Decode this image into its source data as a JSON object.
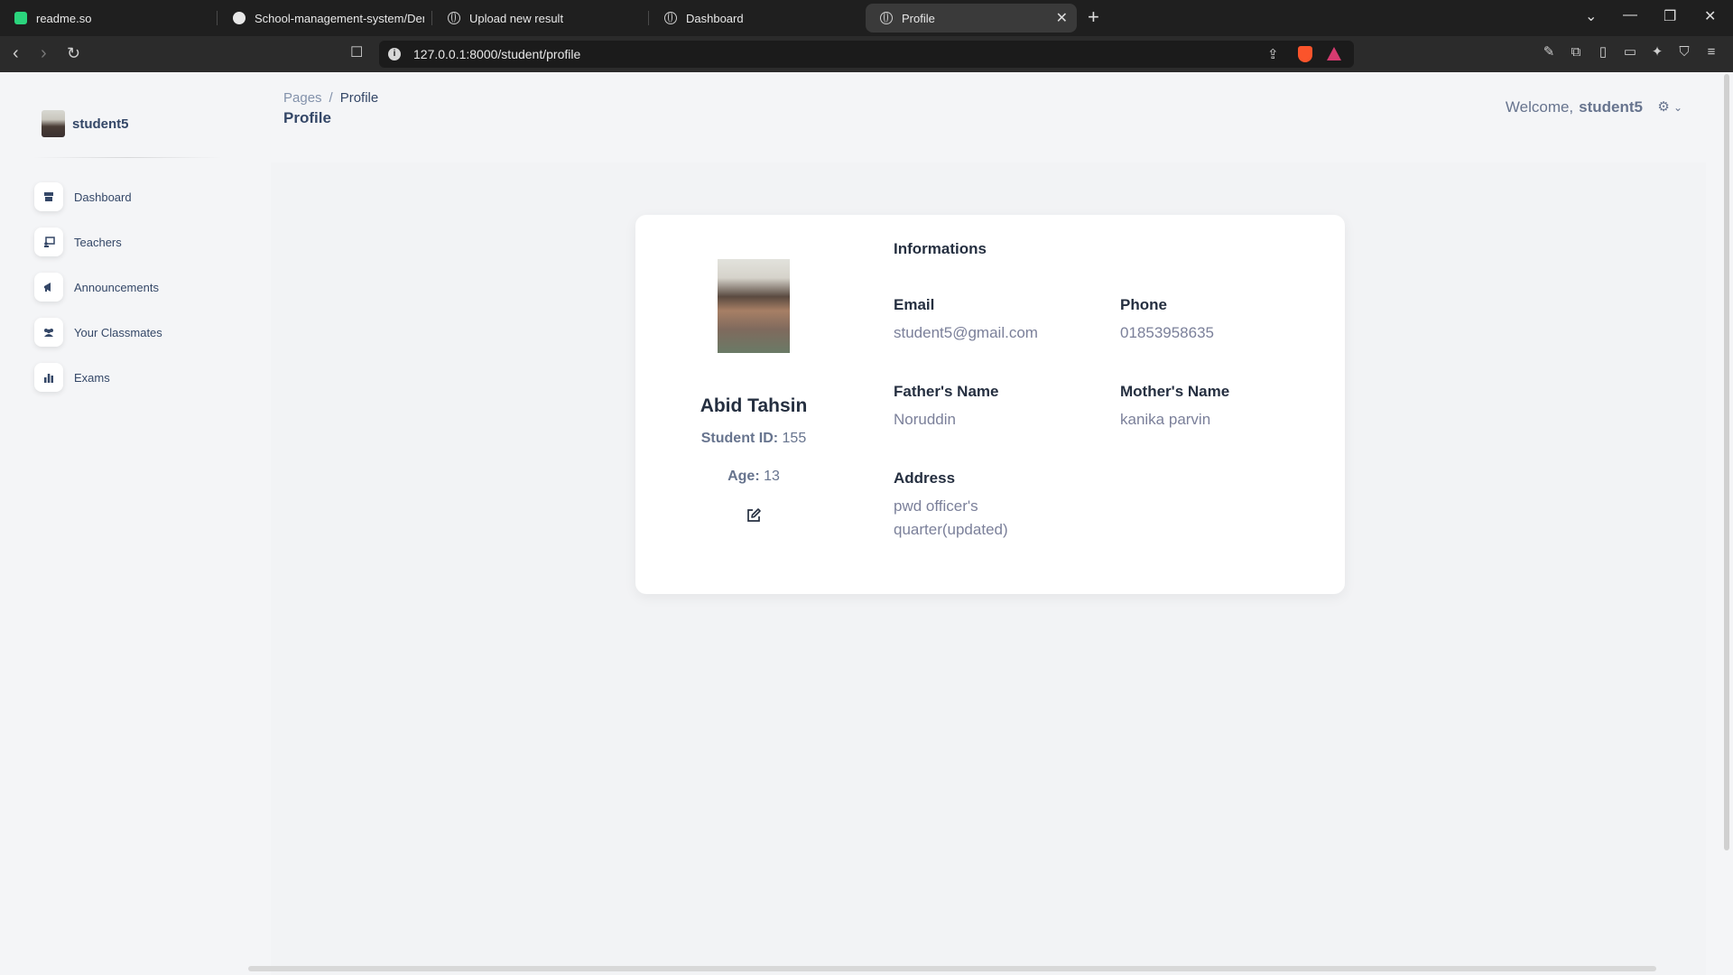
{
  "browser": {
    "tabs": [
      {
        "label": "readme.so",
        "icon": "readme-icon"
      },
      {
        "label": "School-management-system/Demo",
        "icon": "github-icon"
      },
      {
        "label": "Upload new result",
        "icon": "globe-icon"
      },
      {
        "label": "Dashboard",
        "icon": "globe-icon"
      },
      {
        "label": "Profile",
        "icon": "globe-icon",
        "active": true
      }
    ],
    "url": "127.0.0.1:8000/student/profile"
  },
  "sidebar": {
    "brand": "student5",
    "items": [
      {
        "label": "Dashboard",
        "icon": "shop-icon"
      },
      {
        "label": "Teachers",
        "icon": "chalkboard-icon"
      },
      {
        "label": "Announcements",
        "icon": "megaphone-icon"
      },
      {
        "label": "Your Classmates",
        "icon": "users-icon"
      },
      {
        "label": "Exams",
        "icon": "chart-bar-icon"
      }
    ]
  },
  "header": {
    "breadcrumb_root": "Pages",
    "breadcrumb_sep": "/",
    "breadcrumb_current": "Profile",
    "title": "Profile",
    "welcome": "Welcome,",
    "username": "student5"
  },
  "profile": {
    "name": "Abid Tahsin",
    "student_id_label": "Student ID:",
    "student_id": "155",
    "age_label": "Age:",
    "age": "13",
    "info_title": "Informations",
    "email_label": "Email",
    "email": "student5@gmail.com",
    "phone_label": "Phone",
    "phone": "01853958635",
    "father_label": "Father's Name",
    "father": "Noruddin",
    "mother_label": "Mother's Name",
    "mother": "kanika parvin",
    "address_label": "Address",
    "address_line1": "pwd officer's",
    "address_line2": "quarter(updated)"
  }
}
